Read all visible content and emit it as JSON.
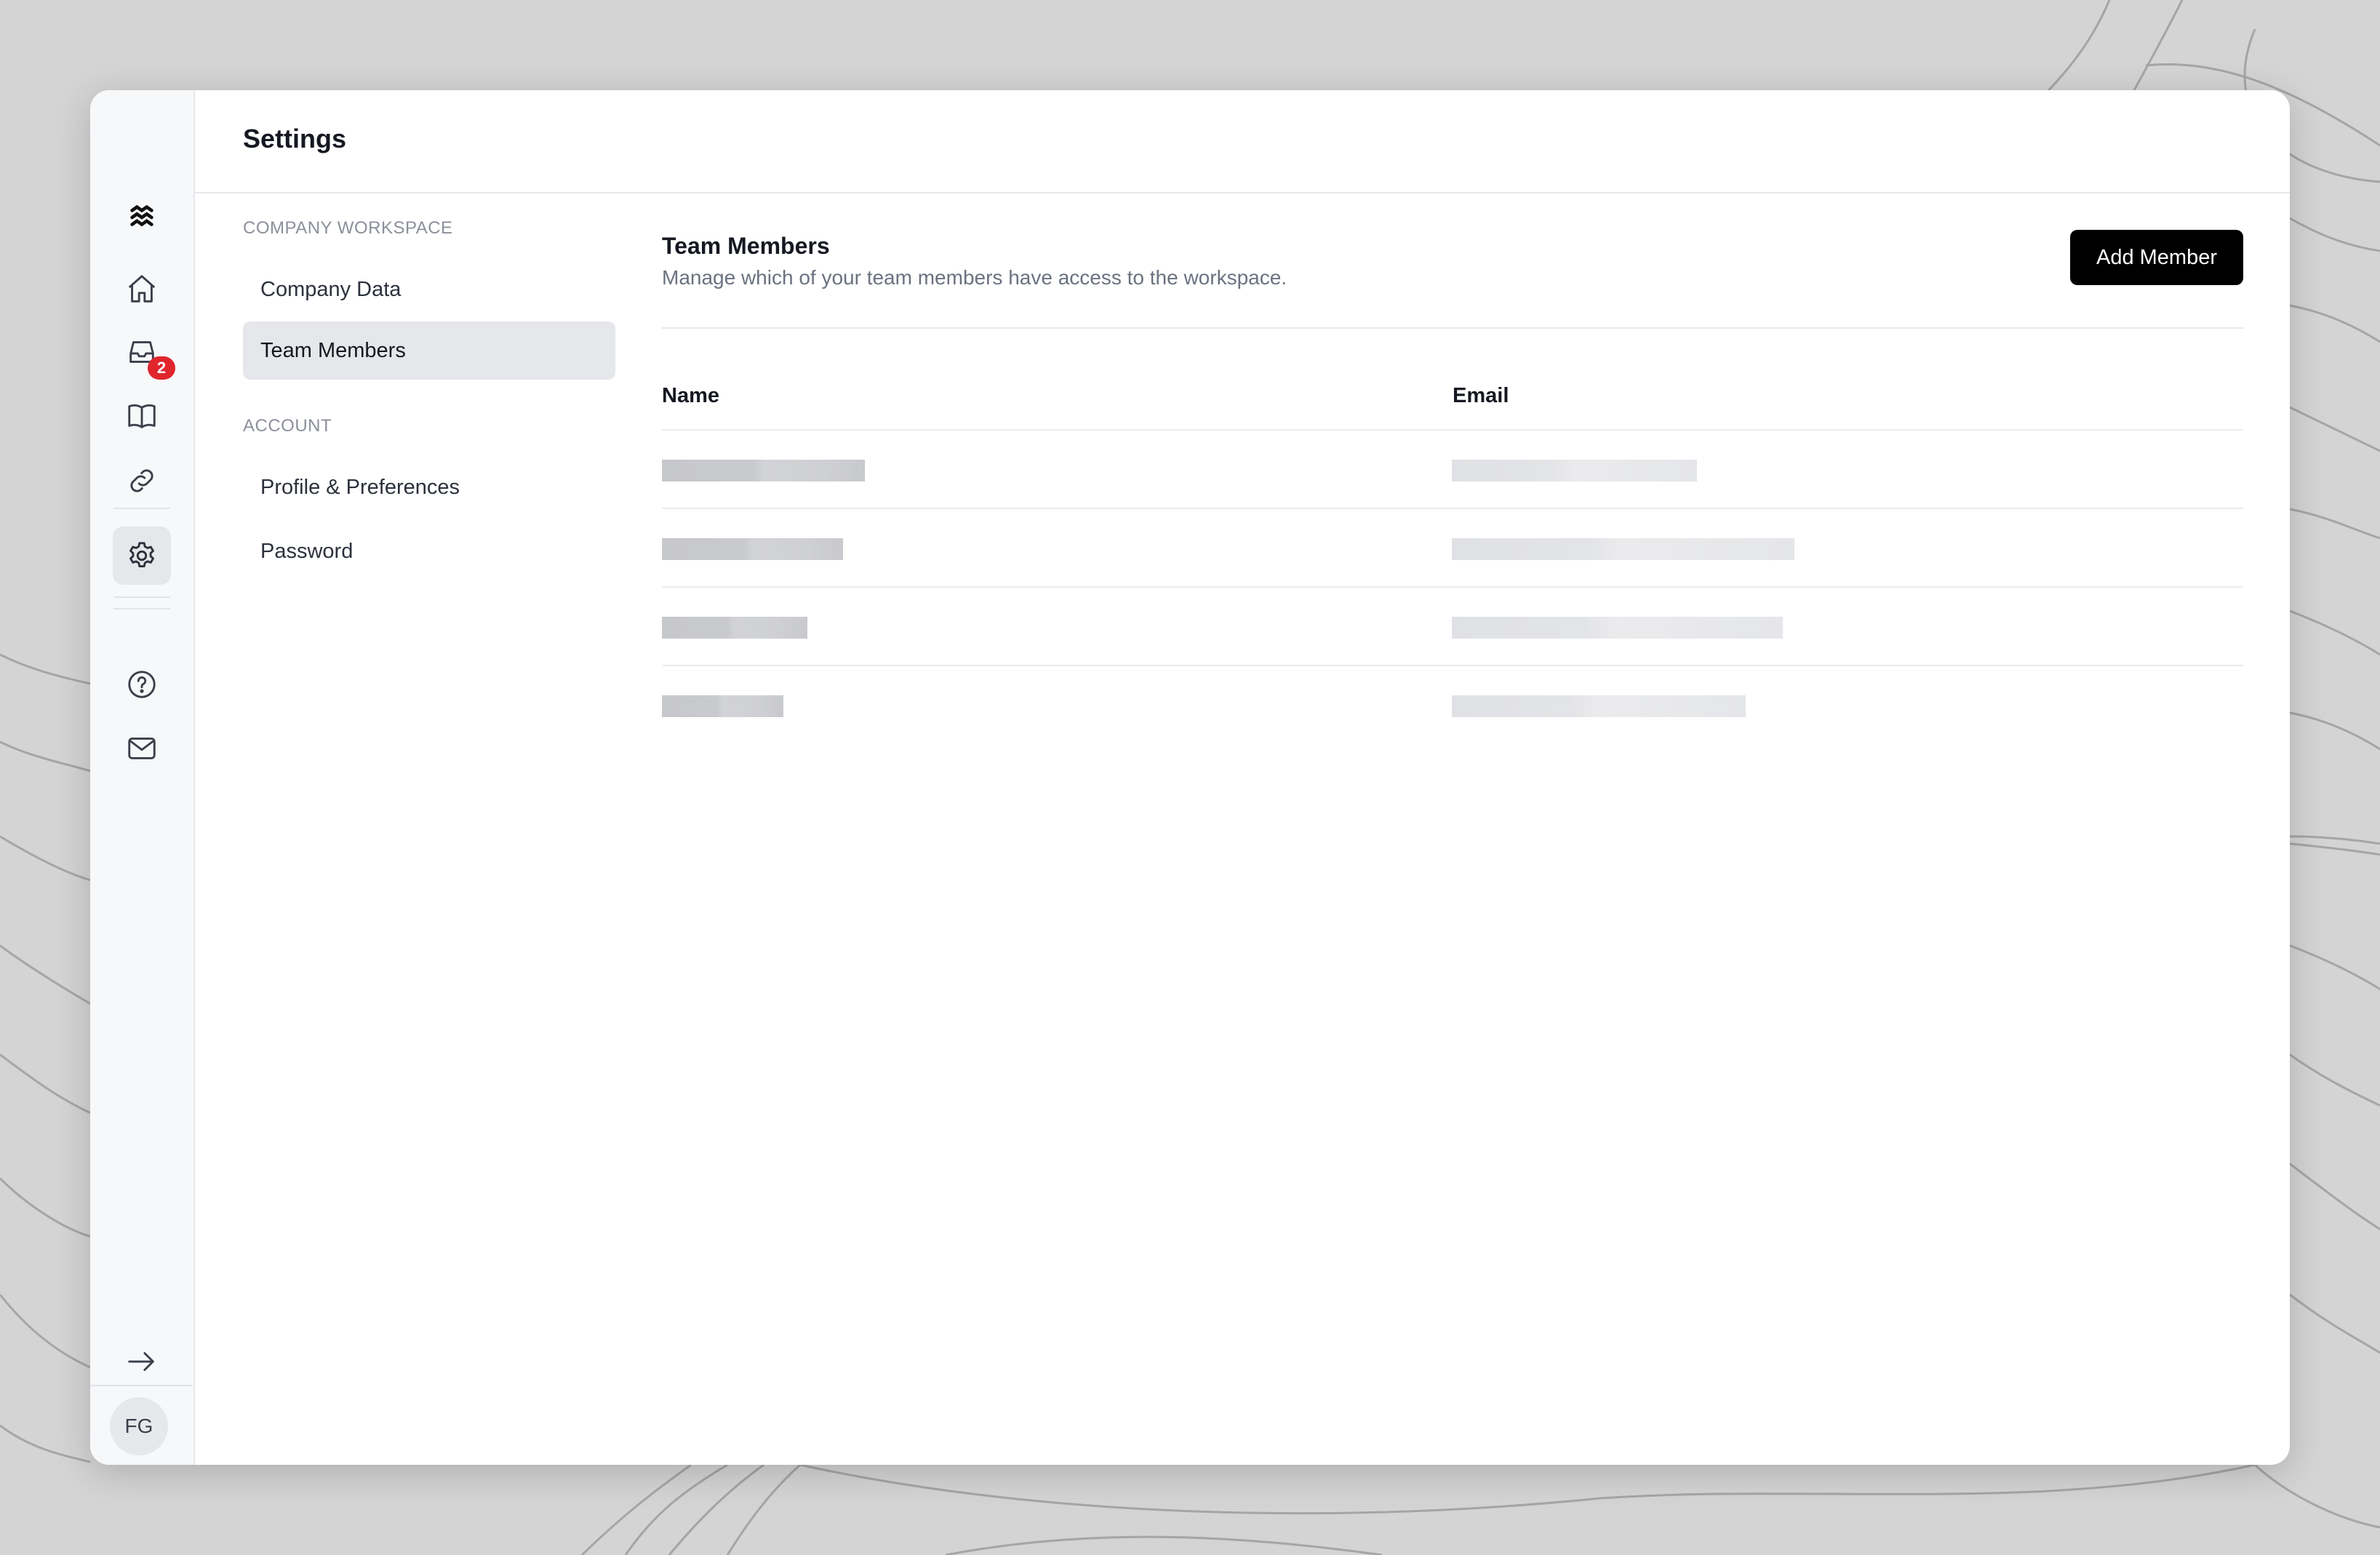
{
  "header": {
    "title": "Settings"
  },
  "rail": {
    "icons": [
      "logo-icon",
      "home-icon",
      "inbox-icon",
      "book-icon",
      "link-icon",
      "globe-icon",
      "gear-icon",
      "help-icon",
      "mail-icon",
      "arrow-right-icon"
    ],
    "inbox_badge": "2",
    "avatar_initials": "FG"
  },
  "nav": {
    "sections": [
      {
        "label": "COMPANY WORKSPACE",
        "items": [
          "Company Data",
          "Team Members"
        ]
      },
      {
        "label": "ACCOUNT",
        "items": [
          "Profile & Preferences",
          "Password"
        ]
      }
    ],
    "active_item": "Team Members"
  },
  "content": {
    "title": "Team Members",
    "description": "Manage which of your team members have access to the workspace.",
    "add_button": "Add Member",
    "columns": [
      "Name",
      "Email"
    ]
  },
  "colors": {
    "accent": "#000000",
    "badge": "#e0262c",
    "active_bg": "#e6e7ea"
  }
}
